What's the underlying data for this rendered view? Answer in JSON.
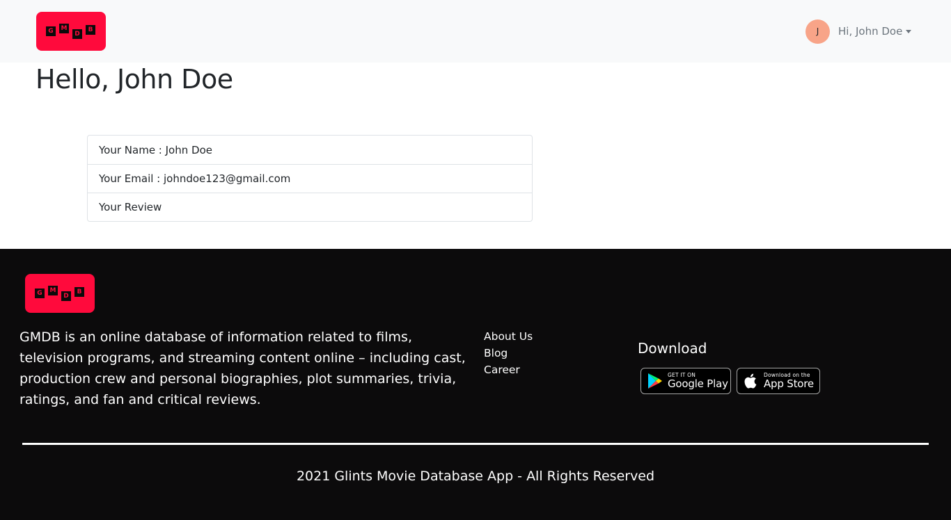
{
  "navbar": {
    "logo_letters": [
      "G",
      "M",
      "D",
      "B"
    ],
    "user_initial": "J",
    "user_greeting": "Hi, John Doe"
  },
  "main": {
    "title": "Hello, John Doe",
    "profile_items": [
      "Your Name : John Doe",
      "Your Email : johndoe123@gmail.com",
      "Your Review"
    ]
  },
  "footer": {
    "logo_letters": [
      "G",
      "M",
      "D",
      "B"
    ],
    "description": "GMDB is an online database of information related to films, television programs, and streaming content online – including cast, production crew and personal biographies, plot summaries, trivia, ratings, and fan and critical reviews.",
    "links": [
      "About Us",
      "Blog",
      "Career"
    ],
    "download_heading": "Download",
    "google_play": {
      "small": "GET IT ON",
      "big": "Google Play"
    },
    "app_store": {
      "small": "Download on the",
      "big": "App Store"
    },
    "copyright": "2021 Glints Movie Database App - All Rights Reserved"
  },
  "colors": {
    "brand_red": "#ff0a3c",
    "navbar_bg": "#f8f9fa",
    "footer_bg": "#0c0b0c",
    "avatar_bg": "#f8a488"
  }
}
